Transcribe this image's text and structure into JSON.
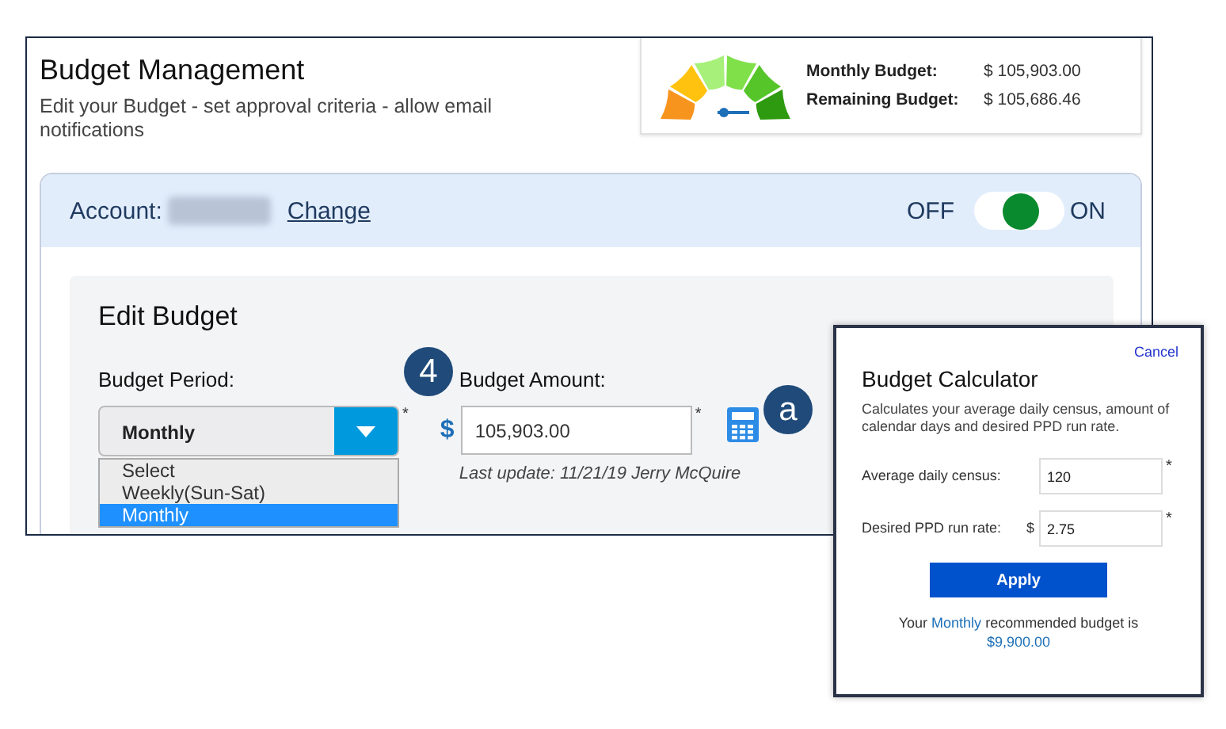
{
  "header": {
    "title": "Budget Management",
    "subtitle": "Edit your Budget - set approval criteria - allow email notifications"
  },
  "summary": {
    "rows": [
      {
        "label": "Monthly Budget:",
        "value": "$ 105,903.00"
      },
      {
        "label": "Remaining Budget:",
        "value": "$ 105,686.46"
      }
    ]
  },
  "account": {
    "label": "Account:",
    "link": "Change",
    "toggle": {
      "off_label": "OFF",
      "on_label": "ON",
      "on": true
    }
  },
  "edit_budget": {
    "title": "Edit Budget",
    "period": {
      "label": "Budget Period:",
      "value": "Monthly",
      "required_mark": "*",
      "options": [
        {
          "label": "Select",
          "selected": false
        },
        {
          "label": "Weekly(Sun-Sat)",
          "selected": false
        },
        {
          "label": "Monthly",
          "selected": true
        }
      ]
    },
    "amount": {
      "step_badge": "4",
      "label": "Budget Amount:",
      "currency": "$",
      "value": "105,903.00",
      "required_mark": "*",
      "note": "Last update: 11/21/19 Jerry McQuire",
      "calculator_badge": "a"
    }
  },
  "calculator": {
    "cancel": "Cancel",
    "title": "Budget Calculator",
    "description": "Calculates your average daily census, amount of calendar days and desired PPD run rate.",
    "fields": [
      {
        "label": "Average daily census:",
        "value": "120",
        "required_mark": "*"
      },
      {
        "label": "Desired PPD run rate:",
        "prefix": "$",
        "value": "2.75",
        "required_mark": "*"
      }
    ],
    "apply": "Apply",
    "result": {
      "before": "Your",
      "period": "Monthly",
      "after": "recommended budget is",
      "amount": "$9,900.00"
    }
  }
}
